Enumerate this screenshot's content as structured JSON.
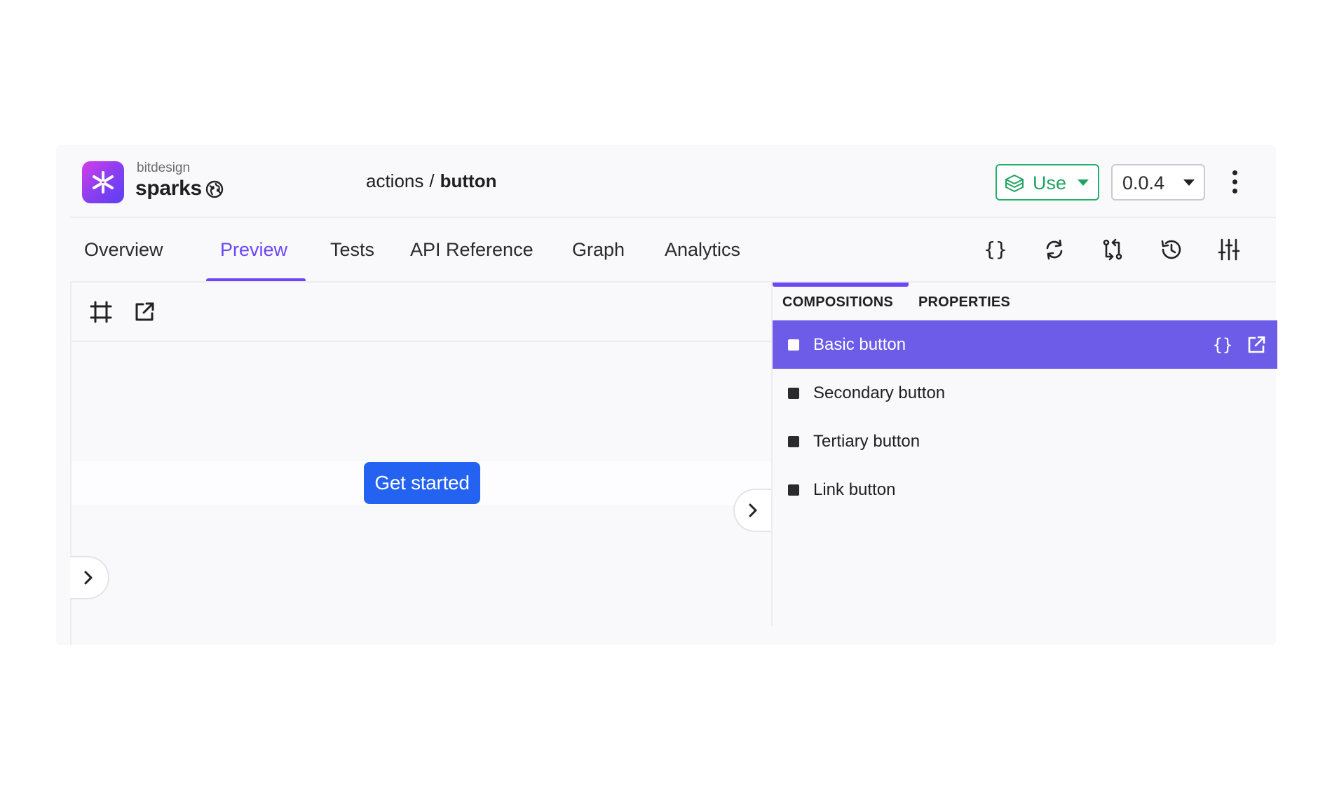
{
  "header": {
    "scope": "bitdesign",
    "component": "sparks",
    "breadcrumb": {
      "namespace": "actions",
      "separator": "/",
      "name": "button"
    },
    "use_label": "Use",
    "version": "0.0.4"
  },
  "tabs": [
    {
      "label": "Overview"
    },
    {
      "label": "Preview",
      "active": true
    },
    {
      "label": "Tests"
    },
    {
      "label": "API Reference"
    },
    {
      "label": "Graph"
    },
    {
      "label": "Analytics"
    }
  ],
  "toolbar_icons": [
    "code-icon",
    "refresh-icon",
    "compare-icon",
    "history-icon",
    "settings-sliders-icon"
  ],
  "preview": {
    "toolbar_icons": [
      "frame-icon",
      "open-external-icon"
    ],
    "button_label": "Get started"
  },
  "side_panel": {
    "tabs": [
      {
        "label": "COMPOSITIONS",
        "active": true
      },
      {
        "label": "PROPERTIES"
      }
    ],
    "compositions": [
      {
        "label": "Basic button",
        "selected": true
      },
      {
        "label": "Secondary button"
      },
      {
        "label": "Tertiary button"
      },
      {
        "label": "Link button"
      }
    ]
  },
  "colors": {
    "accent": "#6c47f5",
    "selected_row": "#6c5ce7",
    "use_green": "#1fa463",
    "primary_button": "#2463f1"
  }
}
